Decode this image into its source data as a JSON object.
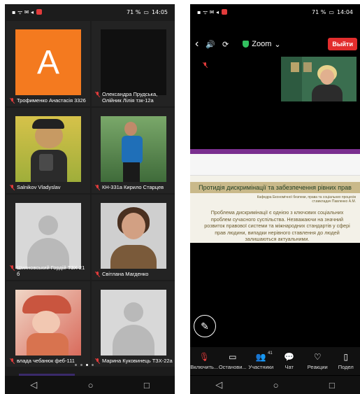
{
  "left_screen": {
    "status": {
      "icons_left": "▪ ᯤ ✉ ◂",
      "battery": "71 %",
      "time": "14:05"
    },
    "tiles": [
      {
        "name": "Трофименко Анастасія 3326",
        "avatar_letter": "A",
        "avatar_color": "#f47a1f"
      },
      {
        "name": "Олександра Прудська, Олійник Лілія тзк-12а"
      },
      {
        "name": "Salnikov Vladyslav"
      },
      {
        "name": "КН-331а Кирило Старцев"
      },
      {
        "name": "Шияновський Гордій ТЗХ 21 б"
      },
      {
        "name": "Світлана Магденко"
      },
      {
        "name": "влада чебанюк феб-111"
      },
      {
        "name": "Марина Куковинець ТЗХ-22а"
      }
    ],
    "nav": [
      "◁",
      "○",
      "□"
    ]
  },
  "right_screen": {
    "status": {
      "battery": "71 %",
      "time": "14:04"
    },
    "topbar": {
      "back": "‹",
      "speaker": "🔊",
      "camera": "⟳",
      "title": "Zoom",
      "chevron": "⌄",
      "leave": "Выйти"
    },
    "slide": {
      "title": "Протидія дискримінації та забезпечення рівних прав",
      "subtitle": "Кафедра Економічної безпеки, права та соціальних процесів ст.викладач Павленко А.М.",
      "body": "Проблема дискримінації є однією з ключових соціальних проблем сучасного суспільства. Незважаючи на значний розвиток правової системи та міжнародних стандартів у сфері прав людини, випадки нерівного ставлення до людей залишаються актуальними."
    },
    "toolbar": [
      {
        "icon": "mic-off",
        "label": "Включить..."
      },
      {
        "icon": "video",
        "label": "Останови..."
      },
      {
        "icon": "participants",
        "label": "Участники",
        "badge": "41"
      },
      {
        "icon": "chat",
        "label": "Чат"
      },
      {
        "icon": "reactions",
        "label": "Реакции"
      },
      {
        "icon": "share",
        "label": "Подел"
      }
    ],
    "nav": [
      "◁",
      "○",
      "□"
    ]
  }
}
